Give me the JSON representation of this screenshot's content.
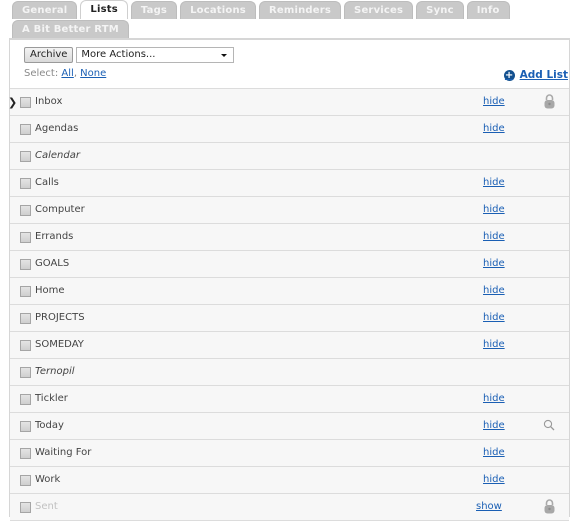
{
  "tabs": {
    "row1": [
      "General",
      "Lists",
      "Tags",
      "Locations",
      "Reminders",
      "Services",
      "Sync",
      "Info"
    ],
    "row2": [
      "A Bit Better RTM"
    ],
    "active": "Lists"
  },
  "toolbar": {
    "archive_label": "Archive",
    "more_actions": "More Actions...",
    "select_label": "Select:",
    "select_all": "All",
    "select_none": "None",
    "add_list": "Add List"
  },
  "colors": {
    "link": "#1a5fb4",
    "row_bg": "#f7f7f7",
    "tab_inactive": "#c9c9c9"
  },
  "lists": [
    {
      "name": "Inbox",
      "action": "hide",
      "icon": "lock-icon",
      "current": true,
      "italic": false,
      "muted": false
    },
    {
      "name": "Agendas",
      "action": "hide",
      "icon": null,
      "current": false,
      "italic": false,
      "muted": false
    },
    {
      "name": "Calendar",
      "action": null,
      "icon": null,
      "current": false,
      "italic": true,
      "muted": false
    },
    {
      "name": "Calls",
      "action": "hide",
      "icon": null,
      "current": false,
      "italic": false,
      "muted": false
    },
    {
      "name": "Computer",
      "action": "hide",
      "icon": null,
      "current": false,
      "italic": false,
      "muted": false
    },
    {
      "name": "Errands",
      "action": "hide",
      "icon": null,
      "current": false,
      "italic": false,
      "muted": false
    },
    {
      "name": "GOALS",
      "action": "hide",
      "icon": null,
      "current": false,
      "italic": false,
      "muted": false
    },
    {
      "name": "Home",
      "action": "hide",
      "icon": null,
      "current": false,
      "italic": false,
      "muted": false
    },
    {
      "name": "PROJECTS",
      "action": "hide",
      "icon": null,
      "current": false,
      "italic": false,
      "muted": false
    },
    {
      "name": "SOMEDAY",
      "action": "hide",
      "icon": null,
      "current": false,
      "italic": false,
      "muted": false
    },
    {
      "name": "Ternopil",
      "action": null,
      "icon": null,
      "current": false,
      "italic": true,
      "muted": false
    },
    {
      "name": "Tickler",
      "action": "hide",
      "icon": null,
      "current": false,
      "italic": false,
      "muted": false
    },
    {
      "name": "Today",
      "action": "hide",
      "icon": "search-icon",
      "current": false,
      "italic": false,
      "muted": false
    },
    {
      "name": "Waiting For",
      "action": "hide",
      "icon": null,
      "current": false,
      "italic": false,
      "muted": false
    },
    {
      "name": "Work",
      "action": "hide",
      "icon": null,
      "current": false,
      "italic": false,
      "muted": false
    },
    {
      "name": "Sent",
      "action": "show",
      "icon": "lock-icon",
      "current": false,
      "italic": false,
      "muted": true
    }
  ]
}
